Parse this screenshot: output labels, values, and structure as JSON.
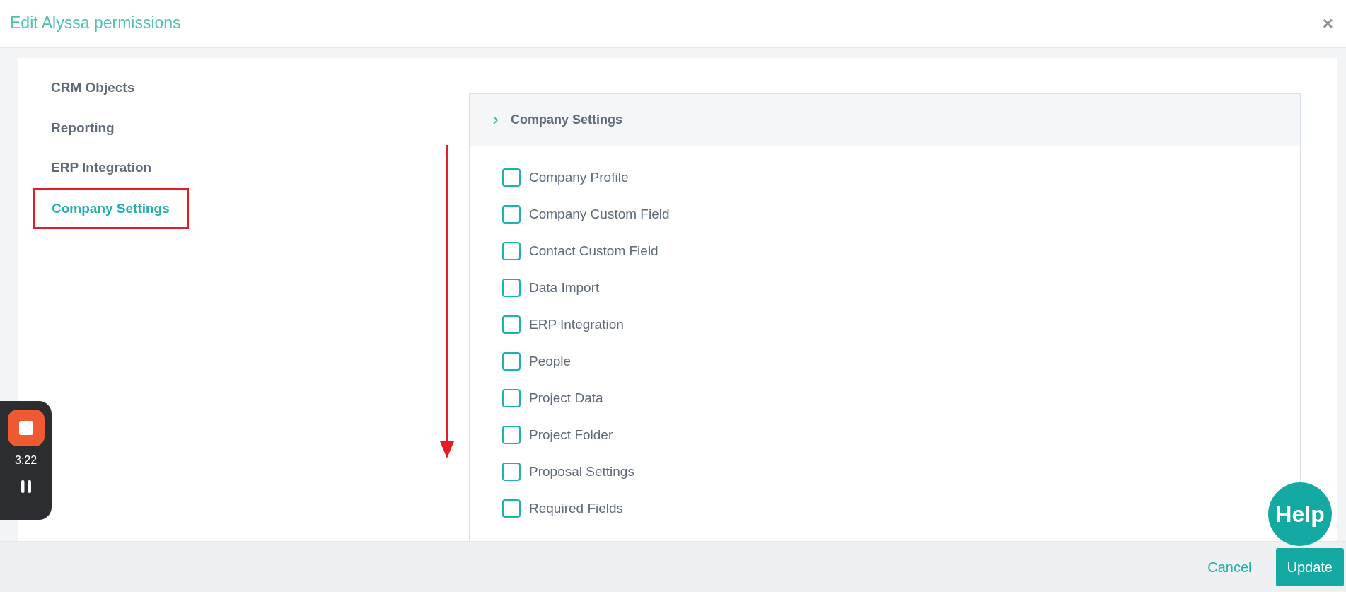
{
  "dialog": {
    "title": "Edit Alyssa permissions",
    "close": "×"
  },
  "nav": [
    {
      "label": "CRM Objects",
      "selected": false
    },
    {
      "label": "Reporting",
      "selected": false
    },
    {
      "label": "ERP Integration",
      "selected": false
    },
    {
      "label": "Company Settings",
      "selected": true
    }
  ],
  "annotations": {
    "box_around_selected": true,
    "down_arrow": true
  },
  "panel": {
    "title": "Company Settings",
    "expanded": false,
    "items": [
      {
        "label": "Company Profile",
        "checked": false
      },
      {
        "label": "Company Custom Field",
        "checked": false
      },
      {
        "label": "Contact Custom Field",
        "checked": false
      },
      {
        "label": "Data Import",
        "checked": false
      },
      {
        "label": "ERP Integration",
        "checked": false
      },
      {
        "label": "People",
        "checked": false
      },
      {
        "label": "Project Data",
        "checked": false
      },
      {
        "label": "Project Folder",
        "checked": false
      },
      {
        "label": "Proposal Settings",
        "checked": false
      },
      {
        "label": "Required Fields",
        "checked": false
      }
    ]
  },
  "footer": {
    "cancel": "Cancel",
    "update": "Update"
  },
  "help": "Help",
  "recorder": {
    "time": "3:22"
  }
}
